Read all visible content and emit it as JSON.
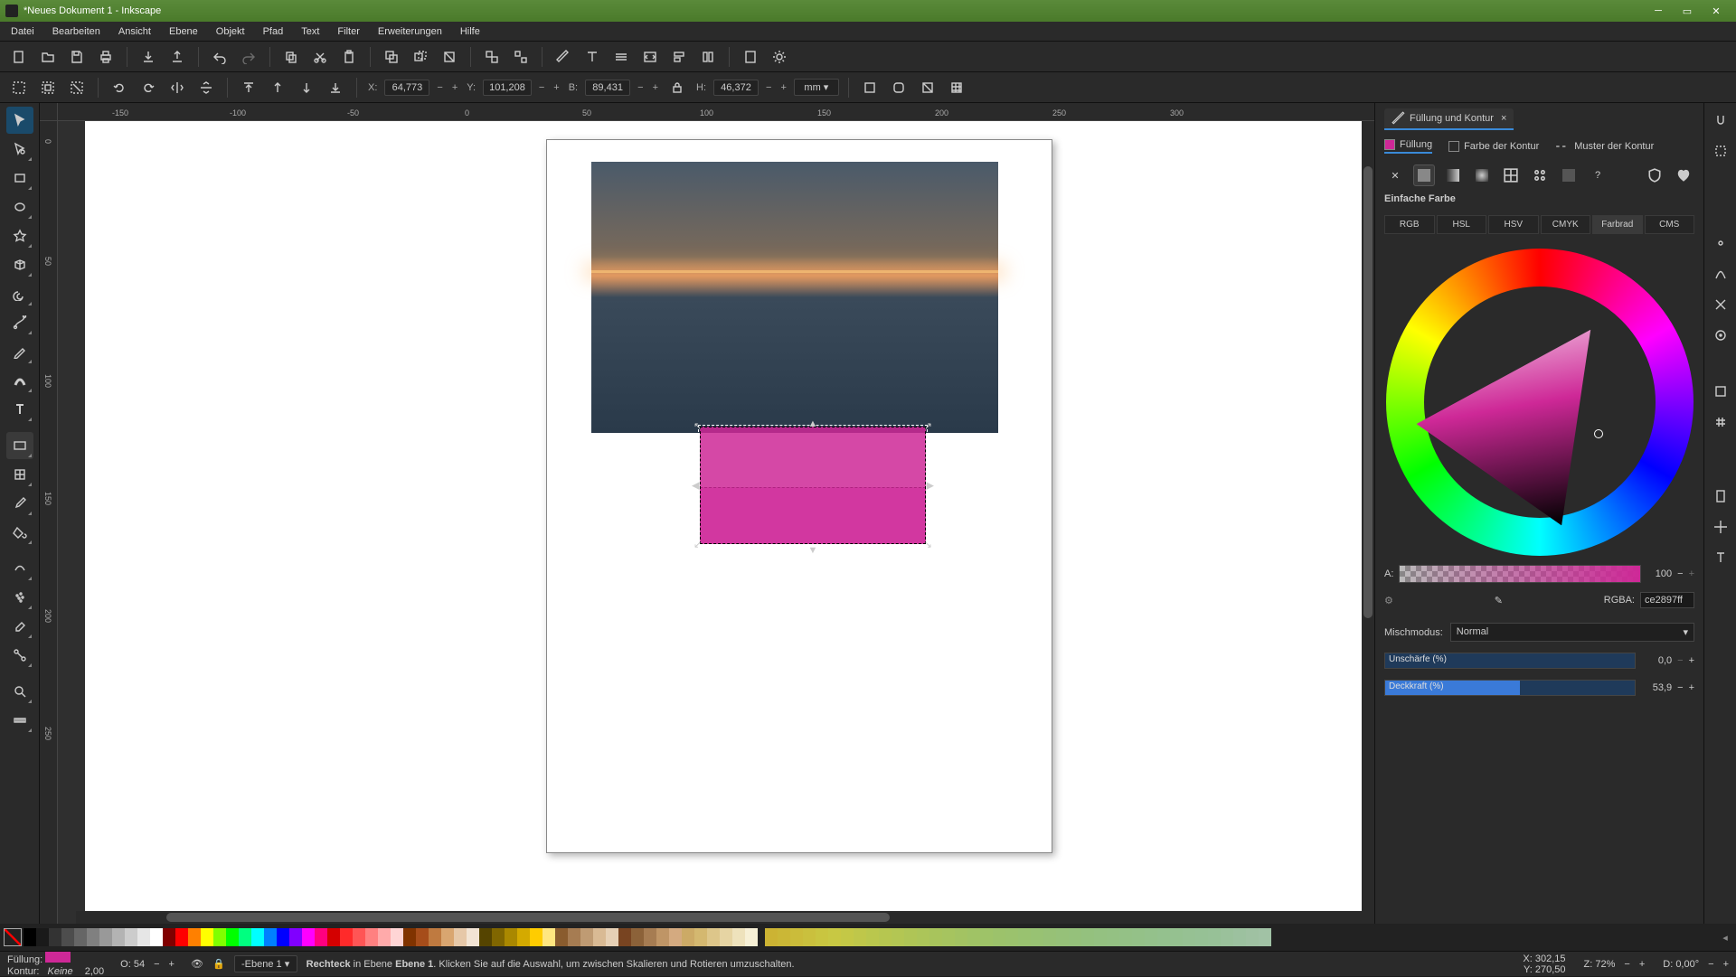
{
  "window": {
    "title": "*Neues Dokument 1 - Inkscape"
  },
  "menu": {
    "items": [
      "Datei",
      "Bearbeiten",
      "Ansicht",
      "Ebene",
      "Objekt",
      "Pfad",
      "Text",
      "Filter",
      "Erweiterungen",
      "Hilfe"
    ]
  },
  "tooloptions": {
    "x_label": "X:",
    "x": "64,773",
    "y_label": "Y:",
    "y": "101,208",
    "w_label": "B:",
    "w": "89,431",
    "h_label": "H:",
    "h": "46,372",
    "unit": "mm"
  },
  "ruler_h": [
    "-150",
    "-100",
    "-50",
    "0",
    "50",
    "100",
    "150",
    "200",
    "250",
    "300"
  ],
  "ruler_v": [
    "0",
    "50",
    "100",
    "150",
    "200",
    "250"
  ],
  "panel": {
    "title": "Füllung und Kontur",
    "tab_fill": "Füllung",
    "tab_stroke": "Farbe der Kontur",
    "tab_strokestyle": "Muster der Kontur",
    "mode_label": "Einfache Farbe",
    "colortabs": [
      "RGB",
      "HSL",
      "HSV",
      "CMYK",
      "Farbrad",
      "CMS"
    ],
    "colortab_active": "Farbrad",
    "alpha_label": "A:",
    "alpha_value": "100",
    "rgba_label": "RGBA:",
    "rgba_value": "ce2897ff",
    "blend_label": "Mischmodus:",
    "blend_value": "Normal",
    "blur_label": "Unschärfe (%)",
    "blur_value": "0,0",
    "opacity_label": "Deckkraft (%)",
    "opacity_value": "53,9",
    "opacity_pct": 54
  },
  "status": {
    "fill_label": "Füllung:",
    "stroke_label": "Kontur:",
    "stroke_value": "Keine",
    "strokewidth": "2,00",
    "o_label": "O:",
    "o_value": "54",
    "layer": "-Ebene 1",
    "message_prefix": "Rechteck",
    "message_mid": " in Ebene ",
    "message_layer": "Ebene 1",
    "message_rest": ". Klicken Sie auf die Auswahl, um zwischen Skalieren und Rotieren umzuschalten.",
    "coord_x_label": "X:",
    "coord_x": "302,15",
    "coord_y_label": "Y:",
    "coord_y": "270,50",
    "zoom_label": "Z:",
    "zoom": "72%",
    "rot_label": "D:",
    "rot": "0,00°"
  },
  "palette_colors": [
    "#000",
    "#1a1a1a",
    "#333",
    "#4d4d4d",
    "#666",
    "#808080",
    "#999",
    "#b3b3b3",
    "#ccc",
    "#e6e6e6",
    "#fff",
    "#800000",
    "#f00",
    "#ff8000",
    "#ff0",
    "#80ff00",
    "#0f0",
    "#00ff80",
    "#0ff",
    "#0080ff",
    "#00f",
    "#8000ff",
    "#f0f",
    "#ff0080",
    "#d40000",
    "#ff2a2a",
    "#ff5555",
    "#ff8080",
    "#ffaaaa",
    "#ffd5d5",
    "#803300",
    "#a64d1a",
    "#bf7a40",
    "#d9a670",
    "#e6c8a8",
    "#f2e4d4",
    "#554400",
    "#806600",
    "#aa8800",
    "#d4aa00",
    "#ffcc00",
    "#ffe680",
    "#8a5c2e",
    "#a67c52",
    "#bf9b73",
    "#d9ba94",
    "#e6d0b5",
    "#784421",
    "#8c6239",
    "#a67c52",
    "#bf9566",
    "#d4aa80",
    "#ccaa66",
    "#d4b870",
    "#ddc68a",
    "#e6d4a3",
    "#eee2bc",
    "#f7f0d6"
  ]
}
